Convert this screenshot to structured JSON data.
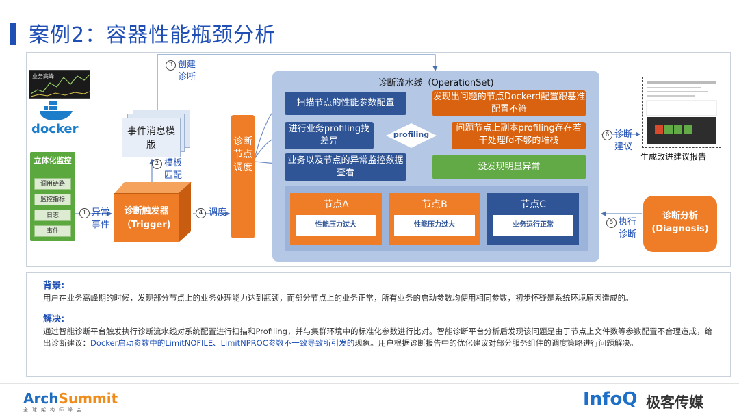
{
  "title": "案例2：容器性能瓶颈分析",
  "mini_chart_label": "业务高峰",
  "docker_label": "docker",
  "monitor_panel": {
    "title": "立体化监控",
    "items": [
      "调用链路",
      "监控指标",
      "日志",
      "事件"
    ]
  },
  "steps": {
    "s1": {
      "num": "1",
      "label": "异常事件"
    },
    "s2": {
      "num": "2",
      "label": "模板匹配"
    },
    "s3": {
      "num": "3",
      "label": "创建诊断"
    },
    "s4": {
      "num": "4",
      "label": "调度"
    },
    "s5": {
      "num": "5",
      "label": "执行诊断"
    },
    "s6": {
      "num": "6",
      "label": "诊断建议"
    }
  },
  "template_label": "事件消息模版",
  "trigger_label": "诊断触发器（Trigger)",
  "scheduler_label": "诊断节点调度",
  "pipeline": {
    "title": "诊断流水线（OperationSet)",
    "rows": [
      {
        "action": "扫描节点的性能参数配置",
        "finding": "发现出问题的节点Dockerd配置跟基准配置不符"
      },
      {
        "action": "进行业务profiling找差异",
        "finding": "问题节点上副本profiling存在若干处理fd不够的堆栈"
      },
      {
        "action": "业务以及节点的异常监控数据查看",
        "finding": "没发现明显异常"
      }
    ],
    "diamond_label": "profiling",
    "nodes": [
      {
        "name": "节点A",
        "status": "性能压力过大"
      },
      {
        "name": "节点B",
        "status": "性能压力过大"
      },
      {
        "name": "节点C",
        "status": "业务运行正常"
      }
    ]
  },
  "diagnosis_label": "诊断分析(Diagnosis)",
  "report_caption": "生成改进建议报告",
  "background": {
    "head": "背景:",
    "text": "用户在业务高峰期的时候，发现部分节点上的业务处理能力达到瓶颈，而部分节点上的业务正常，所有业务的启动参数均使用相同参数，初步怀疑是系统环境原因造成的。"
  },
  "solution": {
    "head": "解决:",
    "text_a": "通过智能诊断平台触发执行诊断流水线对系统配置进行扫描和Profiling，并与集群环境中的标准化参数进行比对。智能诊断平台分析后发现该问题是由于节点上文件数等参数配置不合理造成，给出诊断建议：",
    "highlight": "Docker启动参数中的LimitNOFILE、LimitNPROC参数不一致导致所引发的",
    "text_b": "现象。用户根据诊断报告中的优化建议对部分服务组件的调度策略进行问题解决。"
  },
  "footer": {
    "arch_a": "Arch",
    "arch_b": "Summit",
    "arch_sub": "全球架构师峰会",
    "infoq": "InfoQ",
    "infoq_cn": "极客传媒"
  },
  "colors": {
    "blue": "#1f4fb5",
    "orange": "#ef7d27",
    "green": "#62aa45",
    "navy": "#2f5597"
  }
}
